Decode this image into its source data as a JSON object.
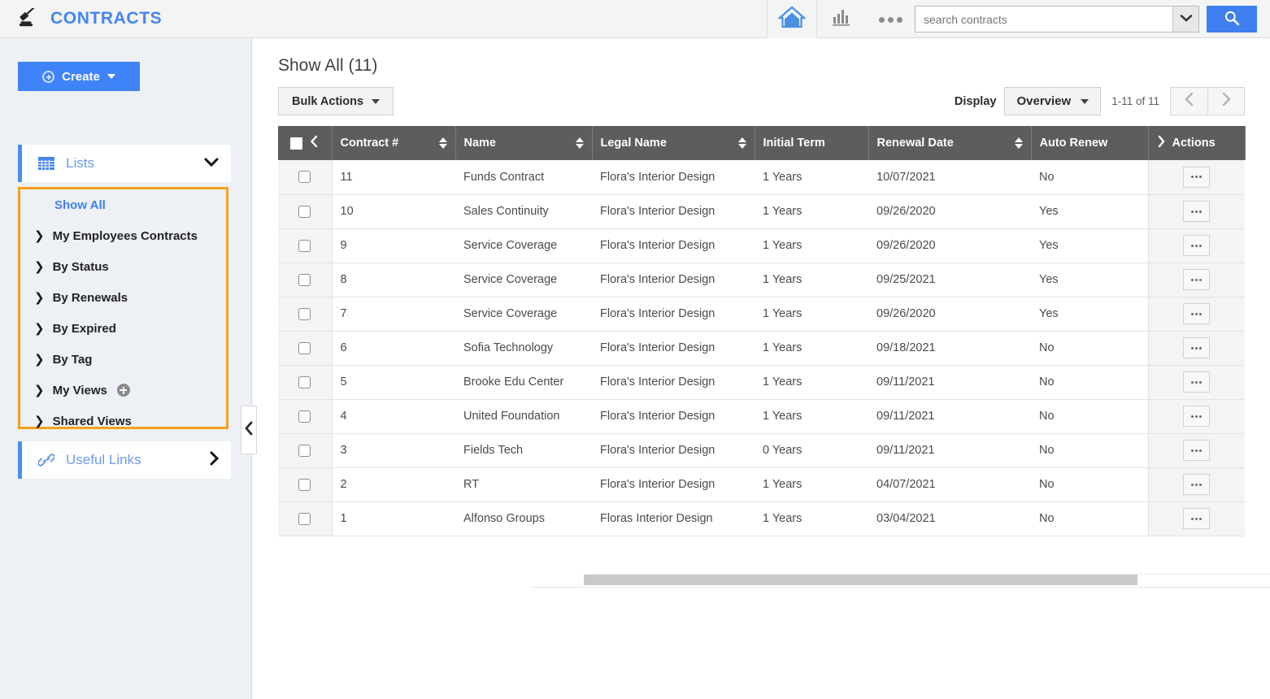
{
  "app": {
    "brand_title": "CONTRACTS",
    "brand_icon": "gavel-icon",
    "accent_blue": "#3f7fef",
    "highlight_orange": "#f5a219",
    "header_gray": "#5d5d5d"
  },
  "topbar": {
    "home_icon": "home-icon",
    "chart_icon": "bar-chart-icon",
    "more_icon": "ellipsis-icon",
    "search_placeholder": "search contracts",
    "search_value": "",
    "search_dropdown_icon": "chevron-down-icon",
    "search_button_icon": "search-icon"
  },
  "sidebar": {
    "create_label": "Create",
    "create_icon": "plus-circle-icon",
    "create_caret": "chevron-down-icon",
    "lists_label": "Lists",
    "lists_icon": "grid-icon",
    "lists_caret": "chevron-down-icon",
    "useful_links_label": "Useful Links",
    "useful_links_icon": "link-icon",
    "useful_links_caret": "chevron-right-icon",
    "collapse_icon": "chevron-left-icon",
    "nav_items": [
      {
        "label": "Show All",
        "active": true,
        "chevron": "",
        "plus": false
      },
      {
        "label": "My Employees Contracts",
        "active": false,
        "chevron": "❯",
        "plus": false
      },
      {
        "label": "By Status",
        "active": false,
        "chevron": "❯",
        "plus": false
      },
      {
        "label": "By Renewals",
        "active": false,
        "chevron": "❯",
        "plus": false
      },
      {
        "label": "By Expired",
        "active": false,
        "chevron": "❯",
        "plus": false
      },
      {
        "label": "By Tag",
        "active": false,
        "chevron": "❯",
        "plus": false
      },
      {
        "label": "My Views",
        "active": false,
        "chevron": "❯",
        "plus": true
      },
      {
        "label": "Shared Views",
        "active": false,
        "chevron": "❯",
        "plus": false
      }
    ]
  },
  "main": {
    "title": "Show All",
    "count": "(11)",
    "bulk_actions_label": "Bulk Actions",
    "display_label": "Display",
    "display_value": "Overview",
    "range_label": "1-11 of 11",
    "prev_icon": "chevron-left-icon",
    "next_icon": "chevron-right-icon"
  },
  "table": {
    "columns": [
      {
        "key": "checkbox",
        "label": "",
        "sortable": false
      },
      {
        "key": "contract_no",
        "label": "Contract #",
        "sortable": true
      },
      {
        "key": "name",
        "label": "Name",
        "sortable": true
      },
      {
        "key": "legal_name",
        "label": "Legal Name",
        "sortable": true
      },
      {
        "key": "initial_term",
        "label": "Initial Term",
        "sortable": false
      },
      {
        "key": "renewal_date",
        "label": "Renewal Date",
        "sortable": true
      },
      {
        "key": "auto_renew",
        "label": "Auto Renew",
        "sortable": false
      },
      {
        "key": "actions",
        "label": "Actions",
        "sortable": false
      }
    ],
    "header_collapse_icon": "chevron-left-icon",
    "actions_expand_icon": "chevron-right-icon",
    "row_action_icon": "ellipsis-icon",
    "rows": [
      {
        "contract_no": "11",
        "name": "Funds Contract",
        "legal_name": "Flora's Interior Design",
        "initial_term": "1 Years",
        "renewal_date": "10/07/2021",
        "auto_renew": "No"
      },
      {
        "contract_no": "10",
        "name": "Sales Continuity",
        "legal_name": "Flora's Interior Design",
        "initial_term": "1 Years",
        "renewal_date": "09/26/2020",
        "auto_renew": "Yes"
      },
      {
        "contract_no": "9",
        "name": "Service Coverage",
        "legal_name": "Flora's Interior Design",
        "initial_term": "1 Years",
        "renewal_date": "09/26/2020",
        "auto_renew": "Yes"
      },
      {
        "contract_no": "8",
        "name": "Service Coverage",
        "legal_name": "Flora's Interior Design",
        "initial_term": "1 Years",
        "renewal_date": "09/25/2021",
        "auto_renew": "Yes"
      },
      {
        "contract_no": "7",
        "name": "Service Coverage",
        "legal_name": "Flora's Interior Design",
        "initial_term": "1 Years",
        "renewal_date": "09/26/2020",
        "auto_renew": "Yes"
      },
      {
        "contract_no": "6",
        "name": "Sofia Technology",
        "legal_name": "Flora's Interior Design",
        "initial_term": "1 Years",
        "renewal_date": "09/18/2021",
        "auto_renew": "No"
      },
      {
        "contract_no": "5",
        "name": "Brooke Edu Center",
        "legal_name": "Flora's Interior Design",
        "initial_term": "1 Years",
        "renewal_date": "09/11/2021",
        "auto_renew": "No"
      },
      {
        "contract_no": "4",
        "name": "United Foundation",
        "legal_name": "Flora's Interior Design",
        "initial_term": "1 Years",
        "renewal_date": "09/11/2021",
        "auto_renew": "No"
      },
      {
        "contract_no": "3",
        "name": "Fields Tech",
        "legal_name": "Flora's Interior Design",
        "initial_term": "0 Years",
        "renewal_date": "09/11/2021",
        "auto_renew": "No"
      },
      {
        "contract_no": "2",
        "name": "RT",
        "legal_name": "Flora's Interior Design",
        "initial_term": "1 Years",
        "renewal_date": "04/07/2021",
        "auto_renew": "No"
      },
      {
        "contract_no": "1",
        "name": "Alfonso Groups",
        "legal_name": "Floras Interior Design",
        "initial_term": "1 Years",
        "renewal_date": "03/04/2021",
        "auto_renew": "No"
      }
    ]
  }
}
